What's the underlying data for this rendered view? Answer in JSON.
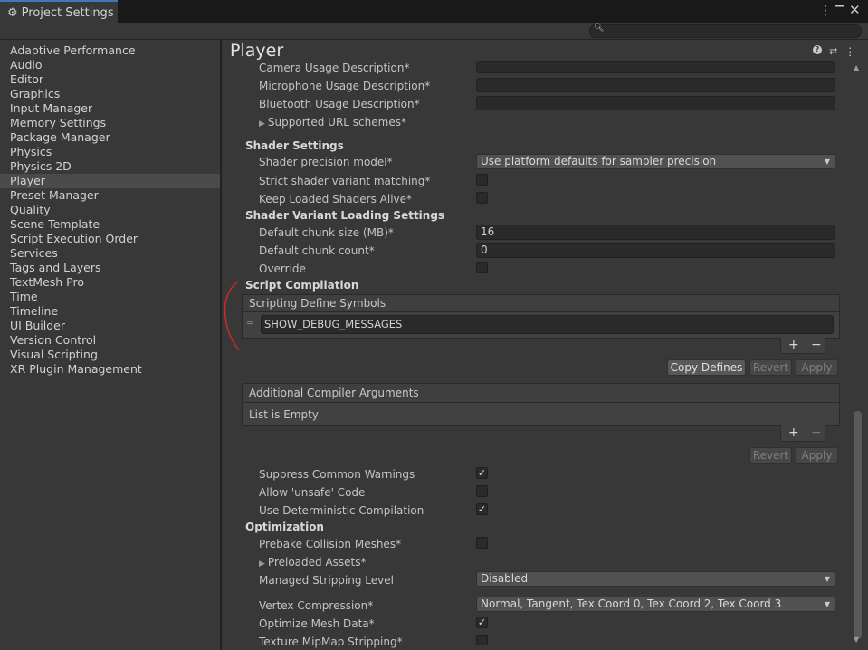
{
  "window": {
    "tab_title": "Project Settings",
    "menu_icon": "kebab-menu-icon",
    "maximize_icon": "maximize-icon",
    "close_icon": "close-icon"
  },
  "search": {
    "placeholder": "",
    "icon": "search-icon"
  },
  "sidebar": {
    "items": [
      "Adaptive Performance",
      "Audio",
      "Editor",
      "Graphics",
      "Input Manager",
      "Memory Settings",
      "Package Manager",
      "Physics",
      "Physics 2D",
      "Player",
      "Preset Manager",
      "Quality",
      "Scene Template",
      "Script Execution Order",
      "Services",
      "Tags and Layers",
      "TextMesh Pro",
      "Time",
      "Timeline",
      "UI Builder",
      "Version Control",
      "Visual Scripting",
      "XR Plugin Management"
    ],
    "selected": "Player"
  },
  "main": {
    "title": "Player",
    "header_icons": [
      "help-icon",
      "presets-icon",
      "kebab-menu-icon"
    ],
    "usage": {
      "camera": "Camera Usage Description*",
      "microphone": "Microphone Usage Description*",
      "bluetooth": "Bluetooth Usage Description*",
      "url_schemes": "Supported URL schemes*",
      "camera_value": "",
      "microphone_value": "",
      "bluetooth_value": ""
    },
    "shader_settings": {
      "header": "Shader Settings",
      "precision_label": "Shader precision model*",
      "precision_value": "Use platform defaults for sampler precision",
      "strict_label": "Strict shader variant matching*",
      "strict_checked": false,
      "keep_loaded_label": "Keep Loaded Shaders Alive*",
      "keep_loaded_checked": false
    },
    "shader_variant_loading": {
      "header": "Shader Variant Loading Settings",
      "chunk_size_label": "Default chunk size (MB)*",
      "chunk_size_value": "16",
      "chunk_count_label": "Default chunk count*",
      "chunk_count_value": "0",
      "override_label": "Override",
      "override_checked": false
    },
    "script_compilation": {
      "header": "Script Compilation",
      "define_symbols_header": "Scripting Define Symbols",
      "define_symbols": [
        "SHOW_DEBUG_MESSAGES"
      ],
      "add": "+",
      "remove": "−",
      "copy_defines": "Copy Defines",
      "revert": "Revert",
      "apply": "Apply",
      "compiler_args_header": "Additional Compiler Arguments",
      "compiler_args_empty": "List is Empty",
      "suppress_label": "Suppress Common Warnings",
      "suppress_checked": true,
      "unsafe_label": "Allow 'unsafe' Code",
      "unsafe_checked": false,
      "deterministic_label": "Use Deterministic Compilation",
      "deterministic_checked": true
    },
    "optimization": {
      "header": "Optimization",
      "prebake_label": "Prebake Collision Meshes*",
      "prebake_checked": false,
      "preloaded_label": "Preloaded Assets*",
      "stripping_label": "Managed Stripping Level",
      "stripping_value": "Disabled",
      "vertex_label": "Vertex Compression*",
      "vertex_value": "Normal, Tangent, Tex Coord 0, Tex Coord 2, Tex Coord 3",
      "optimize_mesh_label": "Optimize Mesh Data*",
      "optimize_mesh_checked": true,
      "mipmap_label": "Texture MipMap Stripping*",
      "mipmap_checked": false
    }
  },
  "colors": {
    "panel": "#383838",
    "titlebar": "#191919",
    "selection": "#4b4b4b",
    "tab_accent": "#3a79bb",
    "annotation": "#c42a2a"
  }
}
